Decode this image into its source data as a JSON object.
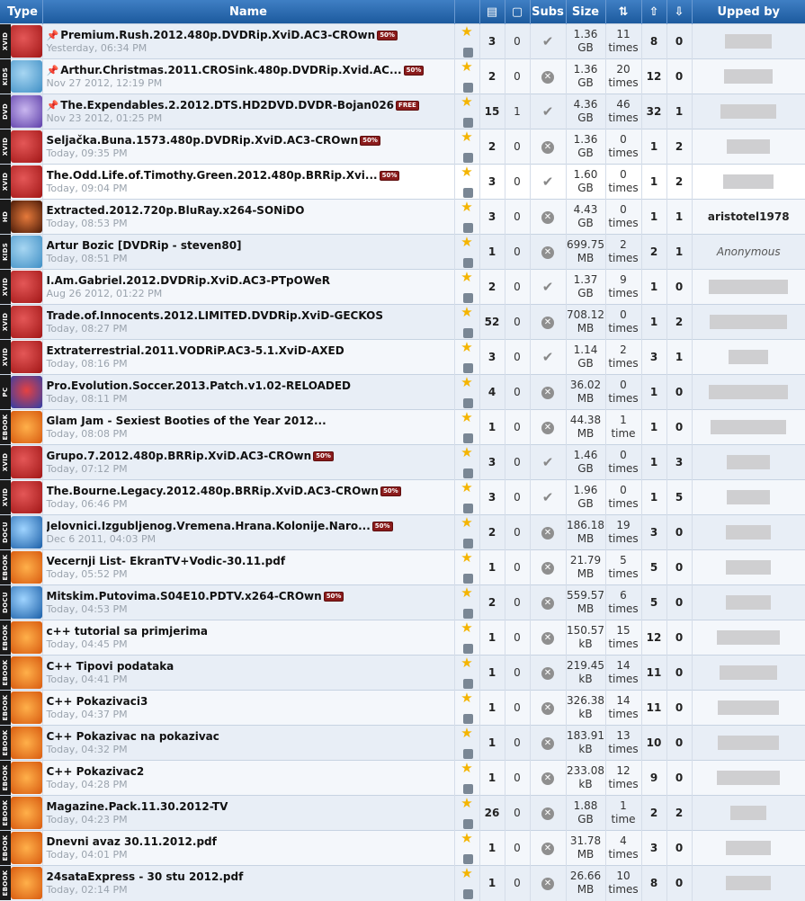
{
  "header": {
    "type": "Type",
    "name": "Name",
    "subs": "Subs",
    "size": "Size",
    "upped_by": "Upped by"
  },
  "colors": {
    "header_bg": "#1c5a9e",
    "row_a": "#e8eef6",
    "row_b": "#f4f7fb",
    "badge": "#8a1b1b"
  },
  "rows": [
    {
      "type": "XVID",
      "icon": "xvid-icon",
      "pinned": true,
      "name": "Premium.Rush.2012.480p.DVDRip.XviD.AC3-CROwn",
      "badge": "50%",
      "date": "Yesterday, 06:34 PM",
      "files": "3",
      "comments": "0",
      "subs": "check",
      "size": "1.36",
      "unit": "GB",
      "done": "11",
      "done_unit": "times",
      "seed": "8",
      "leech": "0",
      "upper": "",
      "upper_w": 52
    },
    {
      "type": "KIDS",
      "icon": "kids-icon",
      "pinned": true,
      "name": "Arthur.Christmas.2011.CROSink.480p.DVDRip.Xvid.AC...",
      "badge": "50%",
      "date": "Nov 27 2012, 12:19 PM",
      "files": "2",
      "comments": "0",
      "subs": "x",
      "size": "1.36",
      "unit": "GB",
      "done": "20",
      "done_unit": "times",
      "seed": "12",
      "leech": "0",
      "upper": "",
      "upper_w": 54
    },
    {
      "type": "DVD",
      "icon": "dvd-icon",
      "pinned": true,
      "name": "The.Expendables.2.2012.DTS.HD2DVD.DVDR-Bojan026",
      "badge": "FREE",
      "date": "Nov 23 2012, 01:25 PM",
      "files": "15",
      "comments": "1",
      "subs": "check",
      "size": "4.36",
      "unit": "GB",
      "done": "46",
      "done_unit": "times",
      "seed": "32",
      "leech": "1",
      "upper": "",
      "upper_w": 62
    },
    {
      "type": "XVID",
      "icon": "xvid-icon",
      "pinned": false,
      "name": "Seljačka.Buna.1573.480p.DVDRip.XviD.AC3-CROwn",
      "badge": "50%",
      "date": "Today, 09:35 PM",
      "files": "2",
      "comments": "0",
      "subs": "x",
      "size": "1.36",
      "unit": "GB",
      "done": "0",
      "done_unit": "times",
      "seed": "1",
      "leech": "2",
      "upper": "",
      "upper_w": 48
    },
    {
      "type": "XVID",
      "icon": "xvid-icon",
      "pinned": false,
      "name": "The.Odd.Life.of.Timothy.Green.2012.480p.BRRip.Xvi...",
      "badge": "50%",
      "date": "Today, 09:04 PM",
      "files": "3",
      "comments": "0",
      "subs": "check",
      "size": "1.60",
      "unit": "GB",
      "done": "0",
      "done_unit": "times",
      "seed": "1",
      "leech": "2",
      "upper": "",
      "upper_w": 56,
      "highlight": true
    },
    {
      "type": "HD",
      "icon": "hd-icon",
      "pinned": false,
      "name": "Extracted.2012.720p.BluRay.x264-SONiDO",
      "badge": "",
      "date": "Today, 08:53 PM",
      "files": "3",
      "comments": "0",
      "subs": "x",
      "size": "4.43",
      "unit": "GB",
      "done": "0",
      "done_unit": "times",
      "seed": "1",
      "leech": "1",
      "upper": "aristotel1978",
      "upper_w": 0
    },
    {
      "type": "KIDS",
      "icon": "kids-icon",
      "pinned": false,
      "name": "Artur Bozic [DVDRip - steven80]",
      "badge": "",
      "date": "Today, 08:51 PM",
      "files": "1",
      "comments": "0",
      "subs": "x",
      "size": "699.75",
      "unit": "MB",
      "done": "2",
      "done_unit": "times",
      "seed": "2",
      "leech": "1",
      "upper": "Anonymous",
      "upper_w": 0,
      "anon": true
    },
    {
      "type": "XVID",
      "icon": "xvid-icon",
      "pinned": false,
      "name": "I.Am.Gabriel.2012.DVDRip.XviD.AC3-PTpOWeR",
      "badge": "",
      "date": "Aug 26 2012, 01:22 PM",
      "files": "2",
      "comments": "0",
      "subs": "check",
      "size": "1.37",
      "unit": "GB",
      "done": "9",
      "done_unit": "times",
      "seed": "1",
      "leech": "0",
      "upper": "",
      "upper_w": 88
    },
    {
      "type": "XVID",
      "icon": "xvid-icon",
      "pinned": false,
      "name": "Trade.of.Innocents.2012.LIMITED.DVDRip.XviD-GECKOS",
      "badge": "",
      "date": "Today, 08:27 PM",
      "files": "52",
      "comments": "0",
      "subs": "x",
      "size": "708.12",
      "unit": "MB",
      "done": "0",
      "done_unit": "times",
      "seed": "1",
      "leech": "2",
      "upper": "",
      "upper_w": 86
    },
    {
      "type": "XVID",
      "icon": "xvid-icon",
      "pinned": false,
      "name": "Extraterrestrial.2011.VODRiP.AC3-5.1.XviD-AXED",
      "badge": "",
      "date": "Today, 08:16 PM",
      "files": "3",
      "comments": "0",
      "subs": "check",
      "size": "1.14",
      "unit": "GB",
      "done": "2",
      "done_unit": "times",
      "seed": "3",
      "leech": "1",
      "upper": "",
      "upper_w": 44
    },
    {
      "type": "PC",
      "icon": "pc-icon",
      "pinned": false,
      "name": "Pro.Evolution.Soccer.2013.Patch.v1.02-RELOADED",
      "badge": "",
      "date": "Today, 08:11 PM",
      "files": "4",
      "comments": "0",
      "subs": "x",
      "size": "36.02",
      "unit": "MB",
      "done": "0",
      "done_unit": "times",
      "seed": "1",
      "leech": "0",
      "upper": "",
      "upper_w": 88
    },
    {
      "type": "EBOOK",
      "icon": "ebook-icon",
      "pinned": false,
      "name": "Glam Jam - Sexiest Booties of the Year 2012...",
      "badge": "",
      "date": "Today, 08:08 PM",
      "files": "1",
      "comments": "0",
      "subs": "x",
      "size": "44.38",
      "unit": "MB",
      "done": "1",
      "done_unit": "time",
      "seed": "1",
      "leech": "0",
      "upper": "",
      "upper_w": 84
    },
    {
      "type": "XVID",
      "icon": "xvid-icon",
      "pinned": false,
      "name": "Grupo.7.2012.480p.BRRip.XviD.AC3-CROwn",
      "badge": "50%",
      "date": "Today, 07:12 PM",
      "files": "3",
      "comments": "0",
      "subs": "check",
      "size": "1.46",
      "unit": "GB",
      "done": "0",
      "done_unit": "times",
      "seed": "1",
      "leech": "3",
      "upper": "",
      "upper_w": 48
    },
    {
      "type": "XVID",
      "icon": "xvid-icon",
      "pinned": false,
      "name": "The.Bourne.Legacy.2012.480p.BRRip.XviD.AC3-CROwn",
      "badge": "50%",
      "date": "Today, 06:46 PM",
      "files": "3",
      "comments": "0",
      "subs": "check",
      "size": "1.96",
      "unit": "GB",
      "done": "0",
      "done_unit": "times",
      "seed": "1",
      "leech": "5",
      "upper": "",
      "upper_w": 48
    },
    {
      "type": "DOCU",
      "icon": "docu-icon",
      "pinned": false,
      "name": "Jelovnici.Izgubljenog.Vremena.Hrana.Kolonije.Naro...",
      "badge": "50%",
      "date": "Dec 6 2011, 04:03 PM",
      "files": "2",
      "comments": "0",
      "subs": "x",
      "size": "186.18",
      "unit": "MB",
      "done": "19",
      "done_unit": "times",
      "seed": "3",
      "leech": "0",
      "upper": "",
      "upper_w": 50
    },
    {
      "type": "EBOOK",
      "icon": "ebook-icon",
      "pinned": false,
      "name": "Vecernji List- EkranTV+Vodic-30.11.pdf",
      "badge": "",
      "date": "Today, 05:52 PM",
      "files": "1",
      "comments": "0",
      "subs": "x",
      "size": "21.79",
      "unit": "MB",
      "done": "5",
      "done_unit": "times",
      "seed": "5",
      "leech": "0",
      "upper": "",
      "upper_w": 50
    },
    {
      "type": "DOCU",
      "icon": "docu-icon",
      "pinned": false,
      "name": "Mitskim.Putovima.S04E10.PDTV.x264-CROwn",
      "badge": "50%",
      "date": "Today, 04:53 PM",
      "files": "2",
      "comments": "0",
      "subs": "x",
      "size": "559.57",
      "unit": "MB",
      "done": "6",
      "done_unit": "times",
      "seed": "5",
      "leech": "0",
      "upper": "",
      "upper_w": 50
    },
    {
      "type": "EBOOK",
      "icon": "ebook-icon",
      "pinned": false,
      "name": "c++ tutorial sa primjerima",
      "badge": "",
      "date": "Today, 04:45 PM",
      "files": "1",
      "comments": "0",
      "subs": "x",
      "size": "150.57",
      "unit": "kB",
      "done": "15",
      "done_unit": "times",
      "seed": "12",
      "leech": "0",
      "upper": "",
      "upper_w": 70
    },
    {
      "type": "EBOOK",
      "icon": "ebook-icon",
      "pinned": false,
      "name": "C++ Tipovi podataka",
      "badge": "",
      "date": "Today, 04:41 PM",
      "files": "1",
      "comments": "0",
      "subs": "x",
      "size": "219.45",
      "unit": "kB",
      "done": "14",
      "done_unit": "times",
      "seed": "11",
      "leech": "0",
      "upper": "",
      "upper_w": 64
    },
    {
      "type": "EBOOK",
      "icon": "ebook-icon",
      "pinned": false,
      "name": "C++ Pokazivaci3",
      "badge": "",
      "date": "Today, 04:37 PM",
      "files": "1",
      "comments": "0",
      "subs": "x",
      "size": "326.38",
      "unit": "kB",
      "done": "14",
      "done_unit": "times",
      "seed": "11",
      "leech": "0",
      "upper": "",
      "upper_w": 68
    },
    {
      "type": "EBOOK",
      "icon": "ebook-icon",
      "pinned": false,
      "name": "C++ Pokazivac na pokazivac",
      "badge": "",
      "date": "Today, 04:32 PM",
      "files": "1",
      "comments": "0",
      "subs": "x",
      "size": "183.91",
      "unit": "kB",
      "done": "13",
      "done_unit": "times",
      "seed": "10",
      "leech": "0",
      "upper": "",
      "upper_w": 68
    },
    {
      "type": "EBOOK",
      "icon": "ebook-icon",
      "pinned": false,
      "name": "C++ Pokazivac2",
      "badge": "",
      "date": "Today, 04:28 PM",
      "files": "1",
      "comments": "0",
      "subs": "x",
      "size": "233.08",
      "unit": "kB",
      "done": "12",
      "done_unit": "times",
      "seed": "9",
      "leech": "0",
      "upper": "",
      "upper_w": 70
    },
    {
      "type": "EBOOK",
      "icon": "ebook-icon",
      "pinned": false,
      "name": "Magazine.Pack.11.30.2012-TV",
      "badge": "",
      "date": "Today, 04:23 PM",
      "files": "26",
      "comments": "0",
      "subs": "x",
      "size": "1.88",
      "unit": "GB",
      "done": "1",
      "done_unit": "time",
      "seed": "2",
      "leech": "2",
      "upper": "",
      "upper_w": 40
    },
    {
      "type": "EBOOK",
      "icon": "ebook-icon",
      "pinned": false,
      "name": "Dnevni avaz 30.11.2012.pdf",
      "badge": "",
      "date": "Today, 04:01 PM",
      "files": "1",
      "comments": "0",
      "subs": "x",
      "size": "31.78",
      "unit": "MB",
      "done": "4",
      "done_unit": "times",
      "seed": "3",
      "leech": "0",
      "upper": "",
      "upper_w": 50
    },
    {
      "type": "EBOOK",
      "icon": "ebook-icon",
      "pinned": false,
      "name": "24sataExpress - 30 stu 2012.pdf",
      "badge": "",
      "date": "Today, 02:14 PM",
      "files": "1",
      "comments": "0",
      "subs": "x",
      "size": "26.66",
      "unit": "MB",
      "done": "10",
      "done_unit": "times",
      "seed": "8",
      "leech": "0",
      "upper": "",
      "upper_w": 50
    }
  ]
}
